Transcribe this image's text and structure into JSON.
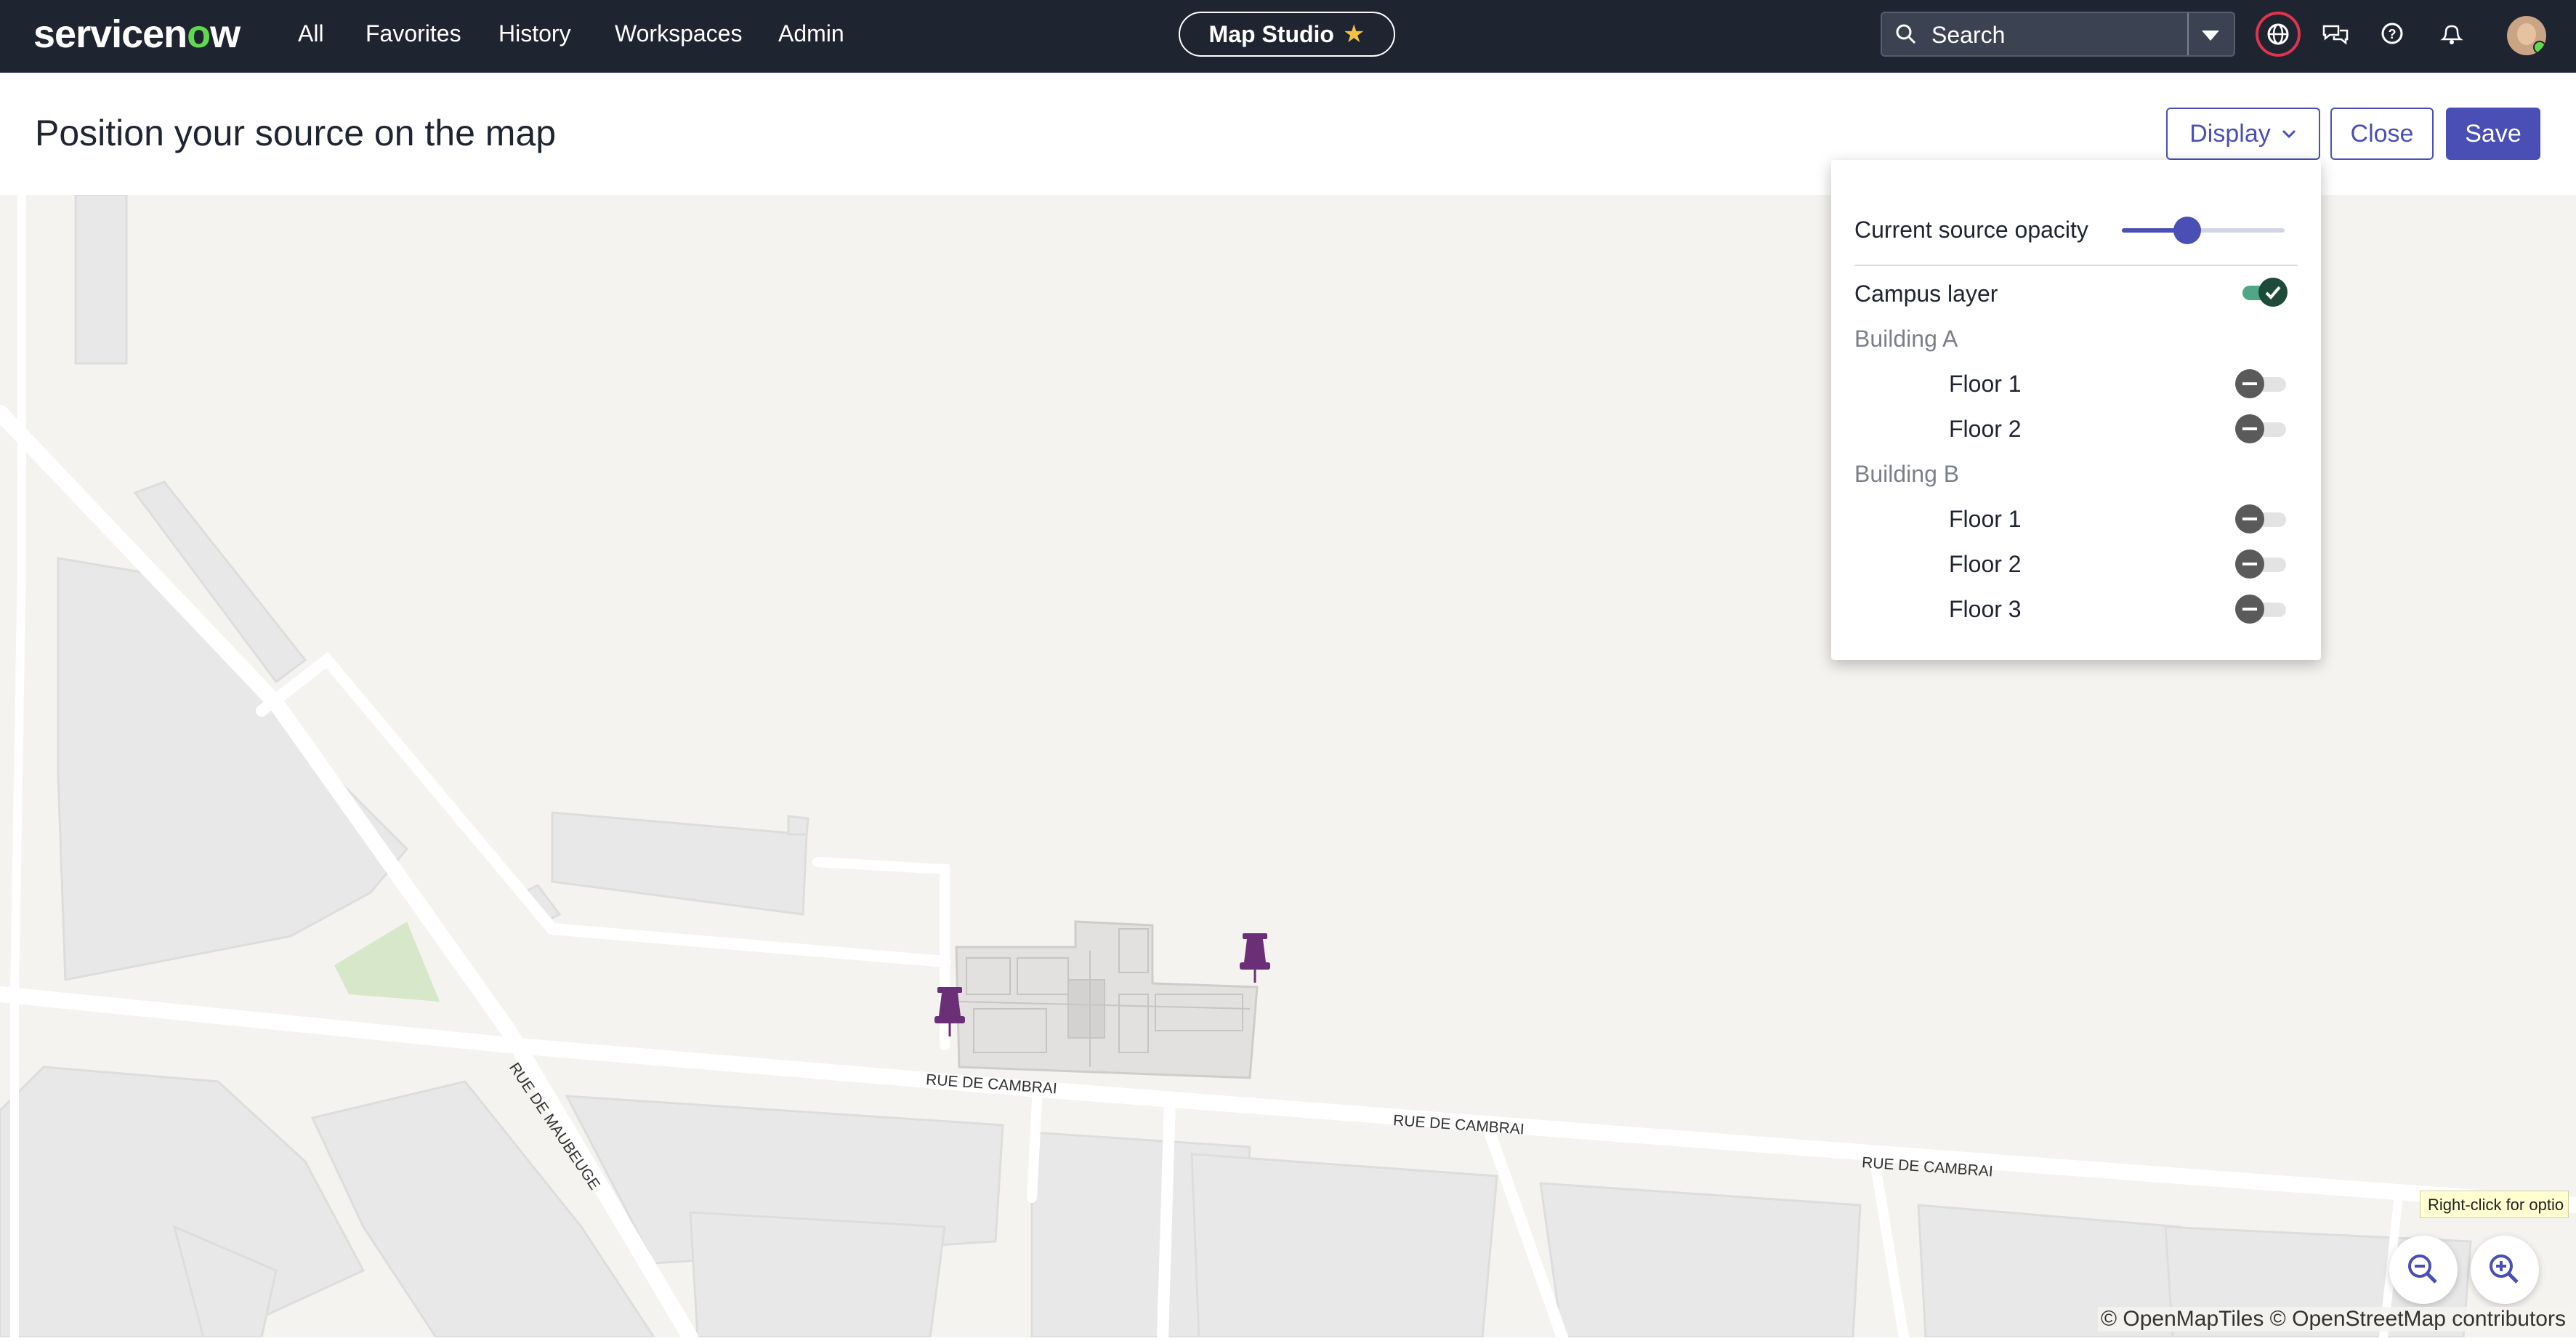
{
  "nav": {
    "logo_prefix": "servicen",
    "logo_o": "o",
    "logo_suffix": "w",
    "links": [
      "All",
      "Favorites",
      "History",
      "Workspaces",
      "Admin"
    ],
    "app_pill": "Map Studio",
    "search_label": "Search",
    "icons": [
      "globe-icon",
      "chat-icon",
      "help-icon",
      "bell-icon"
    ]
  },
  "header": {
    "title": "Position your source on the map",
    "display_button": "Display",
    "close_button": "Close",
    "save_button": "Save"
  },
  "display_panel": {
    "opacity_label": "Current source opacity",
    "opacity_value": 0.4,
    "campus_layer_label": "Campus layer",
    "campus_layer_on": true,
    "building_a": {
      "label": "Building A",
      "floors": [
        "Floor 1",
        "Floor 2"
      ]
    },
    "building_b": {
      "label": "Building B",
      "floors": [
        "Floor 1",
        "Floor 2",
        "Floor 3"
      ]
    }
  },
  "map": {
    "street_labels": [
      "RUE DE CAMBRAI",
      "RUE DE CAMBRAI",
      "RUE DE CAMBRAI",
      "RUE DE MAUBEUGE"
    ],
    "tooltip": "Right-click for optio",
    "attribution": "© OpenMapTiles © OpenStreetMap contributors"
  },
  "colors": {
    "nav_bg": "#1f2431",
    "accent": "#4a4fb5",
    "map_bg": "#f5f3ef",
    "pin": "#6b2f78",
    "toggle_on": "#4ea887"
  }
}
